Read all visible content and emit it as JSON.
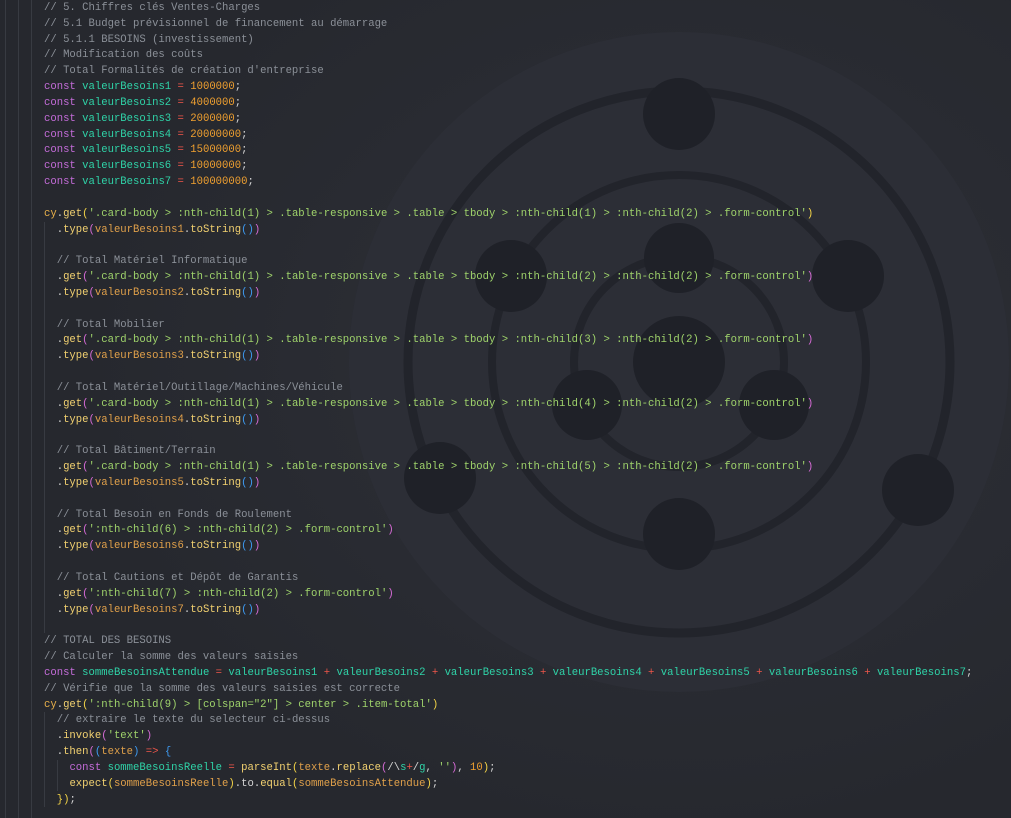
{
  "editor": {
    "language": "javascript",
    "colors": {
      "background": "#26282e",
      "comment": "#8b9098",
      "keyword": "#c46cd9",
      "variable": "#2fd3a8",
      "number": "#f0a030",
      "operator": "#f0564a",
      "string": "#9fd36b",
      "function": "#f2d170"
    },
    "lines": [
      "// 5. Chiffres clés Ventes-Charges",
      "// 5.1 Budget prévisionnel de financement au démarrage",
      "// 5.1.1 BESOINS (investissement)",
      "// Modification des coûts",
      "// Total Formalités de création d'entreprise",
      "const valeurBesoins1 = 1000000;",
      "const valeurBesoins2 = 4000000;",
      "const valeurBesoins3 = 2000000;",
      "const valeurBesoins4 = 20000000;",
      "const valeurBesoins5 = 15000000;",
      "const valeurBesoins6 = 10000000;",
      "const valeurBesoins7 = 100000000;",
      "",
      "cy.get('.card-body > :nth-child(1) > .table-responsive > .table > tbody > :nth-child(1) > :nth-child(2) > .form-control')",
      "  .type(valeurBesoins1.toString())",
      "",
      "  // Total Matériel Informatique",
      "  .get('.card-body > :nth-child(1) > .table-responsive > .table > tbody > :nth-child(2) > :nth-child(2) > .form-control')",
      "  .type(valeurBesoins2.toString())",
      "",
      "  // Total Mobilier",
      "  .get('.card-body > :nth-child(1) > .table-responsive > .table > tbody > :nth-child(3) > :nth-child(2) > .form-control')",
      "  .type(valeurBesoins3.toString())",
      "",
      "  // Total Matériel/Outillage/Machines/Véhicule",
      "  .get('.card-body > :nth-child(1) > .table-responsive > .table > tbody > :nth-child(4) > :nth-child(2) > .form-control')",
      "  .type(valeurBesoins4.toString())",
      "",
      "  // Total Bâtiment/Terrain",
      "  .get('.card-body > :nth-child(1) > .table-responsive > .table > tbody > :nth-child(5) > :nth-child(2) > .form-control')",
      "  .type(valeurBesoins5.toString())",
      "",
      "  // Total Besoin en Fonds de Roulement",
      "  .get(':nth-child(6) > :nth-child(2) > .form-control')",
      "  .type(valeurBesoins6.toString())",
      "",
      "  // Total Cautions et Dépôt de Garantis",
      "  .get(':nth-child(7) > :nth-child(2) > .form-control')",
      "  .type(valeurBesoins7.toString())",
      "",
      "// TOTAL DES BESOINS",
      "// Calculer la somme des valeurs saisies",
      "const sommeBesoinsAttendue = valeurBesoins1 + valeurBesoins2 + valeurBesoins3 + valeurBesoins4 + valeurBesoins5 + valeurBesoins6 + valeurBesoins7;",
      "// Vérifie que la somme des valeurs saisies est correcte",
      "cy.get(':nth-child(9) > [colspan=\"2\"] > center > .item-total')",
      "  // extraire le texte du selecteur ci-dessus",
      "  .invoke('text')",
      "  .then((texte) => {",
      "    const sommeBesoinsReelle = parseInt(texte.replace(/\\s+/g, ''), 10);",
      "    expect(sommeBesoinsReelle).to.equal(sommeBesoinsAttendue);",
      "  });"
    ]
  }
}
